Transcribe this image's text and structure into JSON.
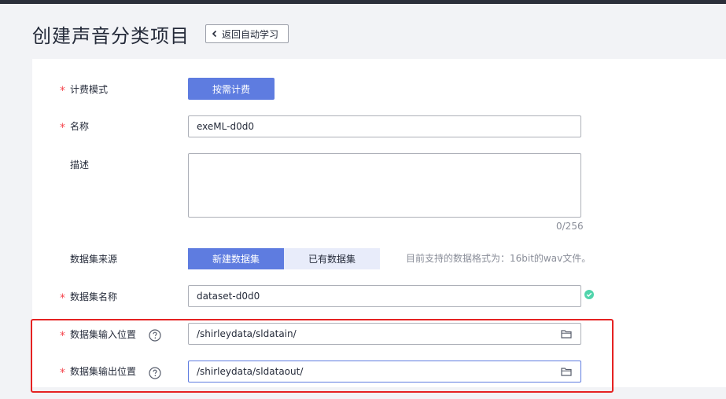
{
  "header": {
    "title": "创建声音分类项目",
    "back_label": "返回自动学习"
  },
  "form": {
    "billing": {
      "label": "计费模式",
      "value": "按需计费"
    },
    "name": {
      "label": "名称",
      "value": "exeML-d0d0"
    },
    "description": {
      "label": "描述",
      "value": "",
      "counter": "0/256"
    },
    "dataset_source": {
      "label": "数据集来源",
      "options": [
        "新建数据集",
        "已有数据集"
      ],
      "selected": "新建数据集",
      "hint": "目前支持的数据格式为：16bit的wav文件。"
    },
    "dataset_name": {
      "label": "数据集名称",
      "value": "dataset-d0d0"
    },
    "input_location": {
      "label": "数据集输入位置",
      "value": "/shirleydata/sldatain/"
    },
    "output_location": {
      "label": "数据集输出位置",
      "value": "/shirleydata/sldataout/"
    }
  },
  "colors": {
    "primary": "#5e7ce0",
    "required": "#f5464e",
    "highlight": "#e52222",
    "success": "#50d4ab"
  }
}
